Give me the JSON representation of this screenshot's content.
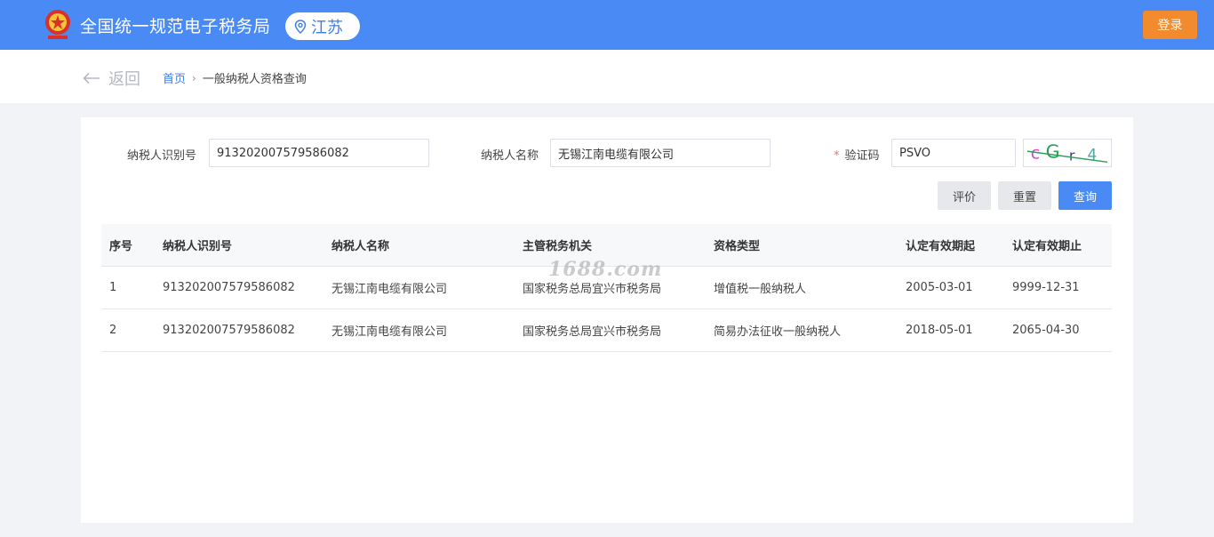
{
  "header": {
    "title": "全国统一规范电子税务局",
    "region": "江苏",
    "login_label": "登录",
    "icons": {
      "emblem": "national-emblem-icon",
      "location": "location-pin-icon"
    },
    "colors": {
      "header_bg": "#4a8af4",
      "login_bg": "#f28a2e"
    }
  },
  "breadcrumb": {
    "back_label": "返回",
    "home": "首页",
    "separator": "›",
    "current": "一般纳税人资格查询"
  },
  "form": {
    "taxpayer_id_label": "纳税人识别号",
    "taxpayer_id_value": "913202007579586082",
    "taxpayer_name_label": "纳税人名称",
    "taxpayer_name_value": "无锡江南电缆有限公司",
    "captcha_required_mark": "*",
    "captcha_label": "验证码",
    "captcha_value": "PSVO",
    "captcha_image_text": "cGr4"
  },
  "actions": {
    "evaluate_label": "评价",
    "reset_label": "重置",
    "query_label": "查询"
  },
  "table": {
    "columns": [
      "序号",
      "纳税人识别号",
      "纳税人名称",
      "主管税务机关",
      "资格类型",
      "认定有效期起",
      "认定有效期止"
    ],
    "rows": [
      [
        "1",
        "913202007579586082",
        "无锡江南电缆有限公司",
        "国家税务总局宜兴市税务局",
        "增值税一般纳税人",
        "2005-03-01",
        "9999-12-31"
      ],
      [
        "2",
        "913202007579586082",
        "无锡江南电缆有限公司",
        "国家税务总局宜兴市税务局",
        "简易办法征收一般纳税人",
        "2018-05-01",
        "2065-04-30"
      ]
    ]
  },
  "watermark": "1688.com"
}
